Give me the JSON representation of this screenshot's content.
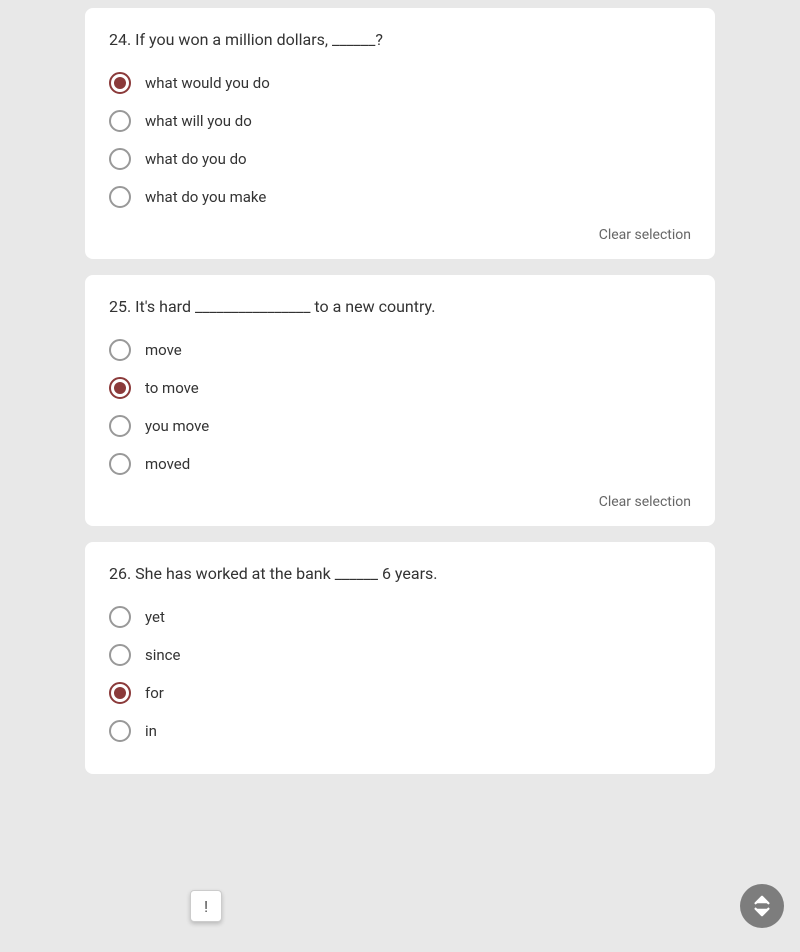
{
  "questions": [
    {
      "id": "q24",
      "number": "24",
      "text": "24. If you won a million dollars, ______?",
      "options": [
        {
          "id": "q24_a",
          "label": "what would you do",
          "selected": true
        },
        {
          "id": "q24_b",
          "label": "what will you do",
          "selected": false
        },
        {
          "id": "q24_c",
          "label": "what do you do",
          "selected": false
        },
        {
          "id": "q24_d",
          "label": "what do you make",
          "selected": false
        }
      ],
      "clear_label": "Clear selection"
    },
    {
      "id": "q25",
      "number": "25",
      "text": "25. It's hard ________________ to a new country.",
      "options": [
        {
          "id": "q25_a",
          "label": "move",
          "selected": false
        },
        {
          "id": "q25_b",
          "label": "to move",
          "selected": true
        },
        {
          "id": "q25_c",
          "label": "you move",
          "selected": false
        },
        {
          "id": "q25_d",
          "label": "moved",
          "selected": false
        }
      ],
      "clear_label": "Clear selection"
    },
    {
      "id": "q26",
      "number": "26",
      "text": "26. She has worked at the bank ______ 6 years.",
      "options": [
        {
          "id": "q26_a",
          "label": "yet",
          "selected": false
        },
        {
          "id": "q26_b",
          "label": "since",
          "selected": false
        },
        {
          "id": "q26_c",
          "label": "for",
          "selected": true
        },
        {
          "id": "q26_d",
          "label": "in",
          "selected": false
        }
      ],
      "clear_label": "Clear selection"
    }
  ],
  "fab": {
    "flag_icon": "!",
    "nav_tooltip": "Navigate"
  }
}
